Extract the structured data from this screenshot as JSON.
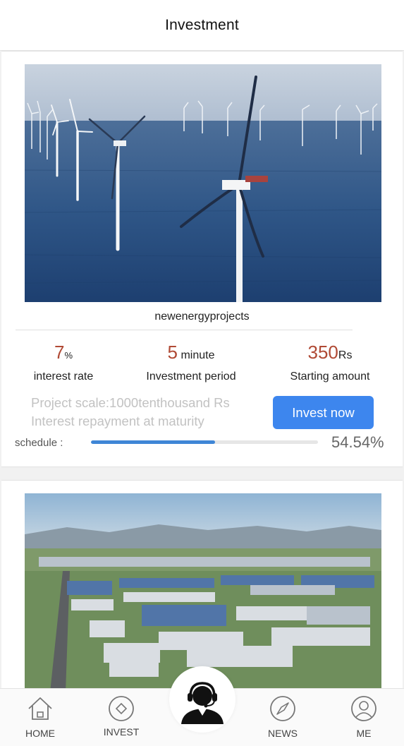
{
  "header": {
    "title": "Investment"
  },
  "projects": [
    {
      "name": "newenergyprojects",
      "image": "offshore-wind-farm-photo",
      "interest_rate": {
        "value": "7",
        "unit": "%",
        "label": "interest rate"
      },
      "period": {
        "value": "5",
        "unit": "minute",
        "label": "Investment period"
      },
      "starting_amount": {
        "value": "350",
        "unit": "Rs",
        "label": "Starting amount"
      },
      "scale_text": "Project scale:1000tenthousand Rs",
      "repayment_text": "Interest repayment at maturity",
      "invest_label": "Invest now",
      "schedule_label": "schedule :",
      "progress_percent": 54.54,
      "progress_text": "54.54%"
    },
    {
      "image": "industrial-park-aerial-photo"
    }
  ],
  "tabbar": {
    "home": "HOME",
    "invest": "INVEST",
    "news": "NEWS",
    "me": "ME",
    "center_icon": "customer-service-headset-icon"
  },
  "colors": {
    "accent_blue": "#3d86ee",
    "stat_number": "#b04a35",
    "progress_fill": "#3f86d6"
  }
}
